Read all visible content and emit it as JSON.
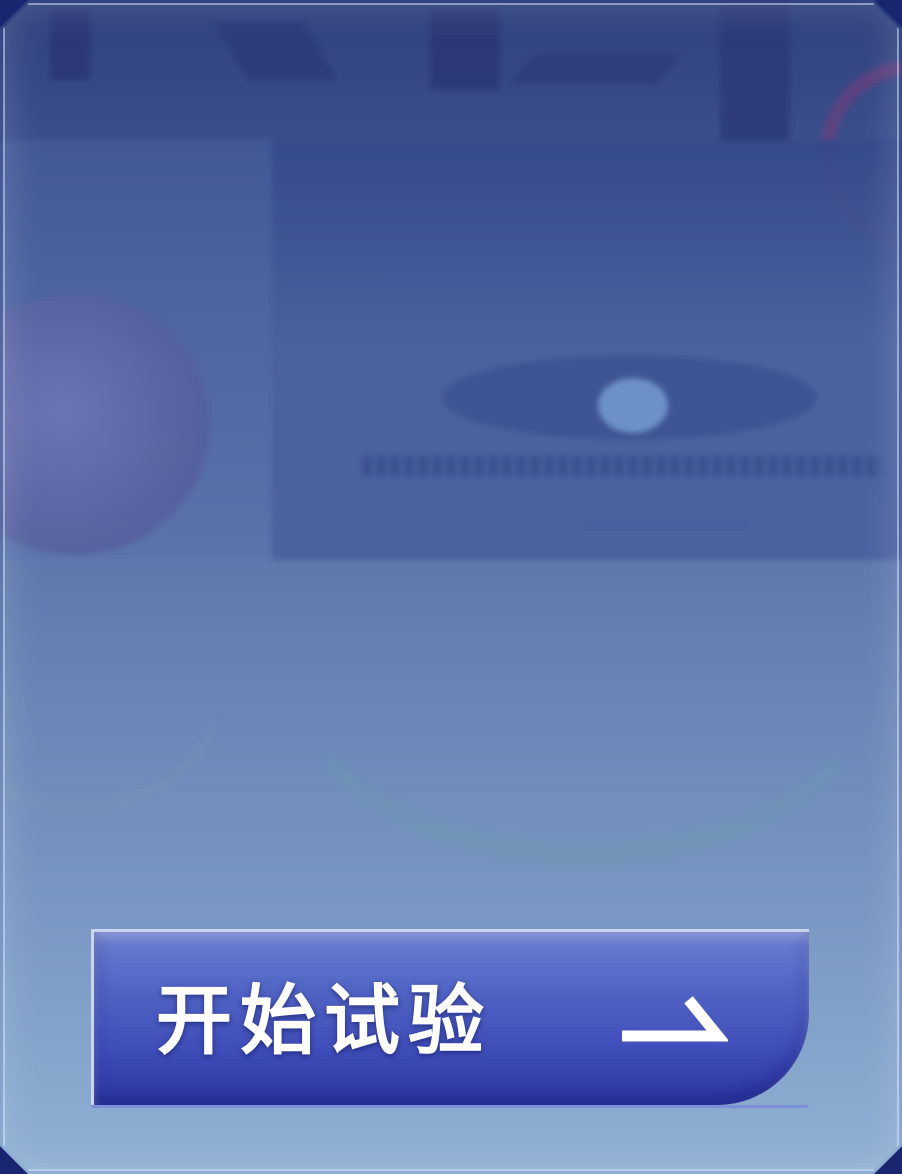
{
  "start_button": {
    "label": "开始试验",
    "icon": "right-arrow-icon"
  },
  "colors": {
    "button_top": "#6d7fd0",
    "button_bottom": "#2d36a3",
    "button_border": "#cbd4ee",
    "label": "#ffffff",
    "panel_top": "#3a4d8c",
    "panel_bottom": "#86a6cd",
    "outer_background": "#1a2570"
  }
}
